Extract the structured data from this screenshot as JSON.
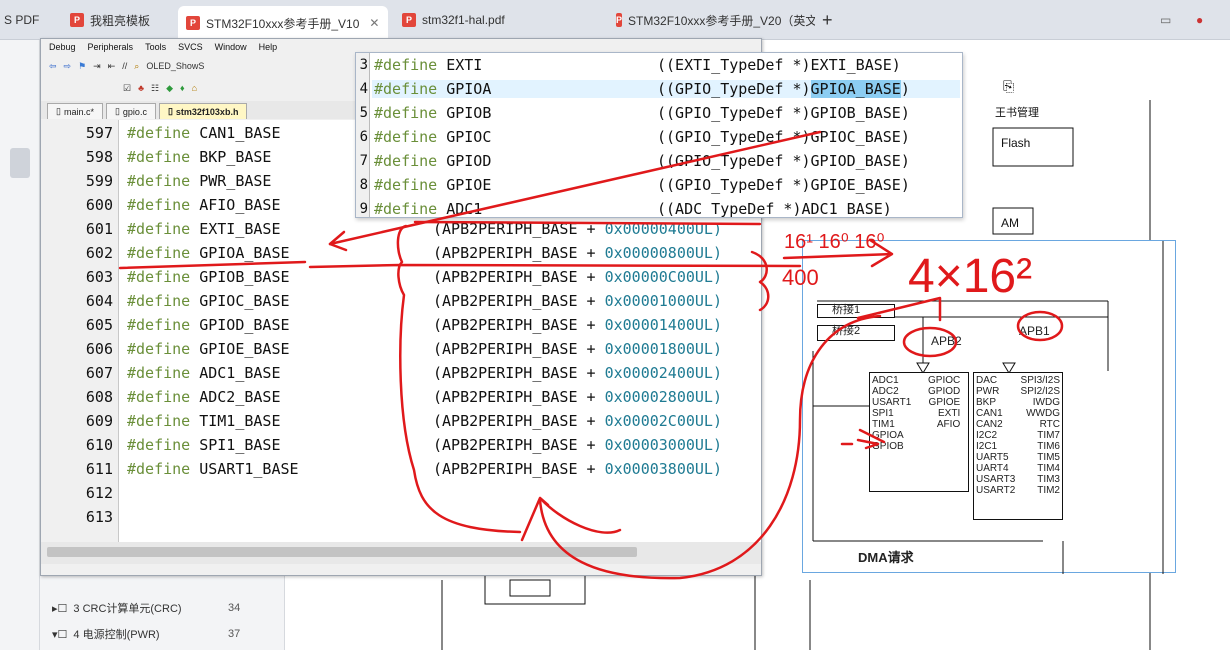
{
  "browser": {
    "tabs": [
      {
        "label": "S PDF"
      },
      {
        "label": "我粗亮模板"
      },
      {
        "label": "STM32F10xxx参考手册_V10"
      },
      {
        "label": "stm32f1-hal.pdf"
      },
      {
        "label": "STM32F10xxx参考手册_V20（英文"
      }
    ],
    "new_tab": "+"
  },
  "ide": {
    "menu": [
      "Debug",
      "Peripherals",
      "Tools",
      "SVCS",
      "Window",
      "Help"
    ],
    "toolbar_label": "OLED_ShowS",
    "file_tabs": [
      {
        "label": "main.c*"
      },
      {
        "label": "gpio.c"
      },
      {
        "label": "stm32f103xb.h"
      }
    ],
    "code_lines": [
      {
        "num": "597",
        "kw": "#define",
        "name": "CAN1_BASE",
        "expr": "",
        "hex": ""
      },
      {
        "num": "598",
        "kw": "#define",
        "name": "BKP_BASE",
        "expr": "",
        "hex": ""
      },
      {
        "num": "599",
        "kw": "#define",
        "name": "PWR_BASE",
        "expr": "",
        "hex": ""
      },
      {
        "num": "600",
        "kw": "#define",
        "name": "AFIO_BASE",
        "expr": "",
        "hex": ""
      },
      {
        "num": "601",
        "kw": "#define",
        "name": "EXTI_BASE",
        "expr": "(APB2PERIPH_BASE + ",
        "hex": "0x00000400UL)"
      },
      {
        "num": "602",
        "kw": "#define",
        "name": "GPIOA_BASE",
        "expr": "(APB2PERIPH_BASE + ",
        "hex": "0x00000800UL)"
      },
      {
        "num": "603",
        "kw": "#define",
        "name": "GPIOB_BASE",
        "expr": "(APB2PERIPH_BASE + ",
        "hex": "0x00000C00UL)"
      },
      {
        "num": "604",
        "kw": "#define",
        "name": "GPIOC_BASE",
        "expr": "(APB2PERIPH_BASE + ",
        "hex": "0x00001000UL)"
      },
      {
        "num": "605",
        "kw": "#define",
        "name": "GPIOD_BASE",
        "expr": "(APB2PERIPH_BASE + ",
        "hex": "0x00001400UL)"
      },
      {
        "num": "606",
        "kw": "#define",
        "name": "GPIOE_BASE",
        "expr": "(APB2PERIPH_BASE + ",
        "hex": "0x00001800UL)"
      },
      {
        "num": "607",
        "kw": "#define",
        "name": "ADC1_BASE",
        "expr": "(APB2PERIPH_BASE + ",
        "hex": "0x00002400UL)"
      },
      {
        "num": "608",
        "kw": "#define",
        "name": "ADC2_BASE",
        "expr": "(APB2PERIPH_BASE + ",
        "hex": "0x00002800UL)"
      },
      {
        "num": "609",
        "kw": "#define",
        "name": "TIM1_BASE",
        "expr": "(APB2PERIPH_BASE + ",
        "hex": "0x00002C00UL)"
      },
      {
        "num": "610",
        "kw": "#define",
        "name": "SPI1_BASE",
        "expr": "(APB2PERIPH_BASE + ",
        "hex": "0x00003000UL)"
      },
      {
        "num": "611",
        "kw": "#define",
        "name": "USART1_BASE",
        "expr": "(APB2PERIPH_BASE + ",
        "hex": "0x00003800UL)"
      },
      {
        "num": "612",
        "kw": "",
        "name": "",
        "expr": "",
        "hex": ""
      },
      {
        "num": "613",
        "kw": "",
        "name": "",
        "expr": "",
        "hex": ""
      }
    ]
  },
  "popup": {
    "lines": [
      {
        "num": "3",
        "kw": "#define",
        "name": "EXTI",
        "expr": "((EXTI_TypeDef *)EXTI_BASE)"
      },
      {
        "num": "4",
        "kw": "#define",
        "name": "GPIOA",
        "expr_pre": "((GPIO_TypeDef *)",
        "expr_sel": "GPIOA_BASE",
        "expr_post": ")"
      },
      {
        "num": "5",
        "kw": "#define",
        "name": "GPIOB",
        "expr": "((GPIO_TypeDef *)GPIOB_BASE)"
      },
      {
        "num": "6",
        "kw": "#define",
        "name": "GPIOC",
        "expr": "((GPIO_TypeDef *)GPIOC_BASE)"
      },
      {
        "num": "7",
        "kw": "#define",
        "name": "GPIOD",
        "expr": "((GPIO_TypeDef *)GPIOD_BASE)"
      },
      {
        "num": "8",
        "kw": "#define",
        "name": "GPIOE",
        "expr": "((GPIO_TypeDef *)GPIOE_BASE)"
      },
      {
        "num": "9",
        "kw": "#define",
        "name": "ADC1",
        "expr": "((ADC_TypeDef *)ADC1_BASE)"
      }
    ]
  },
  "pdf": {
    "bookmarks": [
      {
        "label": "3 CRC计算单元(CRC)",
        "page": "34"
      },
      {
        "label": "4 电源控制(PWR)",
        "page": "37"
      }
    ],
    "right_labels": {
      "flash": "Flash",
      "am": "AM",
      "manage": "王书管理"
    }
  },
  "figure": {
    "bridge1": "桥接1",
    "bridge2": "桥接2",
    "apb2": "APB2",
    "apb1": "APB1",
    "apb2_col1": [
      "ADC1",
      "ADC2",
      "USART1",
      "SPI1",
      "TIM1",
      "GPIOA",
      "GPIOB"
    ],
    "apb2_col2": [
      "GPIOC",
      "GPIOD",
      "GPIOE",
      "EXTI",
      "AFIO"
    ],
    "apb1_col1": [
      "DAC",
      "PWR",
      "BKP",
      "CAN1",
      "CAN2",
      "I2C2",
      "I2C1",
      "UART5",
      "UART4",
      "USART3",
      "USART2"
    ],
    "apb1_col2": [
      "SPI3/I2S",
      "SPI2/I2S",
      "IWDG",
      "WWDG",
      "RTC",
      "TIM7",
      "TIM6",
      "TIM5",
      "TIM4",
      "TIM3",
      "TIM2"
    ],
    "dma": "DMA请求"
  },
  "annotations": {
    "powers": "16¹ 16⁰ 16⁰",
    "value": "400",
    "result": "4×16²"
  }
}
